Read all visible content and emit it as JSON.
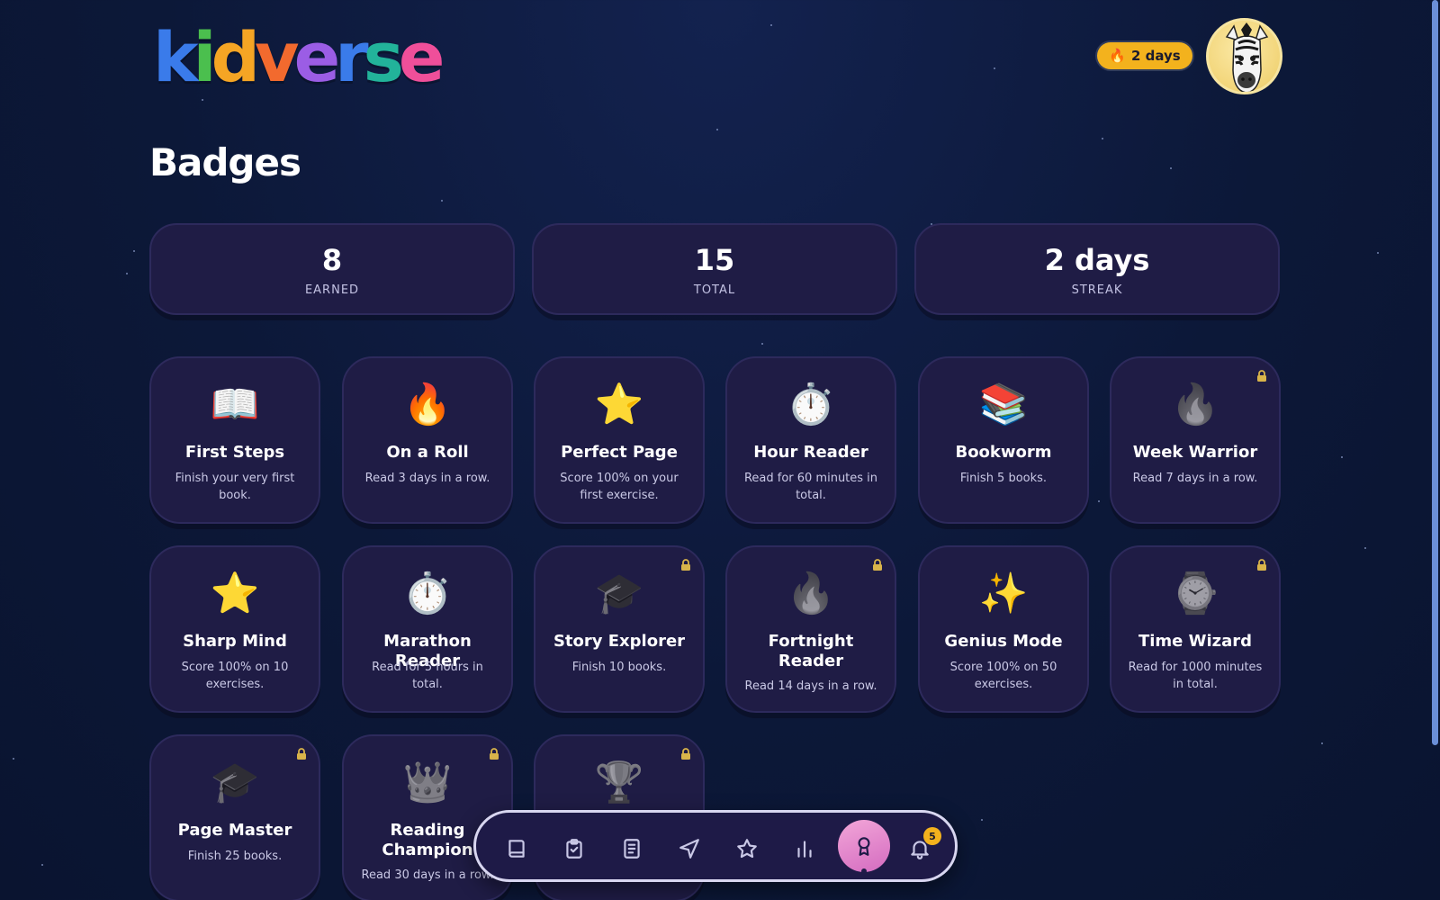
{
  "header": {
    "logo_letters": [
      {
        "char": "k",
        "color": "#3a7bea"
      },
      {
        "char": "i",
        "color": "#4bbf4e"
      },
      {
        "char": "d",
        "color": "#f5a524"
      },
      {
        "char": "v",
        "color": "#f26a2e"
      },
      {
        "char": "e",
        "color": "#9b5de5"
      },
      {
        "char": "r",
        "color": "#3a7bea"
      },
      {
        "char": "s",
        "color": "#22b39a"
      },
      {
        "char": "e",
        "color": "#ef4f9a"
      }
    ],
    "streak_label": "2 days",
    "streak_icon": "fire-icon",
    "avatar_icon": "zebra-avatar"
  },
  "page": {
    "title": "Badges"
  },
  "stats": [
    {
      "value": "8",
      "label": "EARNED"
    },
    {
      "value": "15",
      "label": "TOTAL"
    },
    {
      "value": "2 days",
      "label": "STREAK"
    }
  ],
  "badges": [
    {
      "icon": "📖",
      "icon_name": "open-book-icon",
      "name": "First Steps",
      "desc": "Finish your very first book.",
      "locked": false
    },
    {
      "icon": "🔥",
      "icon_name": "fire-icon",
      "name": "On a Roll",
      "desc": "Read 3 days in a row.",
      "locked": false
    },
    {
      "icon": "⭐",
      "icon_name": "star-icon",
      "name": "Perfect Page",
      "desc": "Score 100% on your first exercise.",
      "locked": false
    },
    {
      "icon": "⏱️",
      "icon_name": "stopwatch-icon",
      "name": "Hour Reader",
      "desc": "Read for 60 minutes in total.",
      "locked": false
    },
    {
      "icon": "📚",
      "icon_name": "books-icon",
      "name": "Bookworm",
      "desc": "Finish 5 books.",
      "locked": false
    },
    {
      "icon": "🔥",
      "icon_name": "fire-icon",
      "name": "Week Warrior",
      "desc": "Read 7 days in a row.",
      "locked": true
    },
    {
      "icon": "⭐",
      "icon_name": "star-icon",
      "name": "Sharp Mind",
      "desc": "Score 100% on 10 exercises.",
      "locked": false
    },
    {
      "icon": "⏱️",
      "icon_name": "stopwatch-icon",
      "name": "Marathon Reader",
      "desc": "Read for 5 hours in total.",
      "locked": false
    },
    {
      "icon": "🎓",
      "icon_name": "graduation-cap-icon",
      "name": "Story Explorer",
      "desc": "Finish 10 books.",
      "locked": true
    },
    {
      "icon": "🔥",
      "icon_name": "fire-icon",
      "name": "Fortnight Reader",
      "desc": "Read 14 days in a row.",
      "locked": true
    },
    {
      "icon": "✨",
      "icon_name": "sparkles-icon",
      "name": "Genius Mode",
      "desc": "Score 100% on 50 exercises.",
      "locked": false
    },
    {
      "icon": "⌚",
      "icon_name": "watch-icon",
      "name": "Time Wizard",
      "desc": "Read for 1000 minutes in total.",
      "locked": true
    },
    {
      "icon": "🎓",
      "icon_name": "graduation-cap-icon",
      "name": "Page Master",
      "desc": "Finish 25 books.",
      "locked": true
    },
    {
      "icon": "👑",
      "icon_name": "crown-icon",
      "name": "Reading Champion",
      "desc": "Read 30 days in a row.",
      "locked": true
    },
    {
      "icon": "🏆",
      "icon_name": "trophy-icon",
      "name": "",
      "desc": "",
      "locked": true
    }
  ],
  "bottom_nav": {
    "items": [
      {
        "icon": "book-icon"
      },
      {
        "icon": "clipboard-check-icon"
      },
      {
        "icon": "document-icon"
      },
      {
        "icon": "navigation-arrow-icon"
      },
      {
        "icon": "star-outline-icon"
      },
      {
        "icon": "bar-chart-icon"
      },
      {
        "icon": "award-ribbon-icon",
        "active": true
      },
      {
        "icon": "bell-icon"
      }
    ],
    "notification_count": "5"
  },
  "colors": {
    "background": "#0c1838",
    "card": "#1f1c45",
    "accent_gold": "#f3b21d",
    "active_pink": "#d46bc0"
  }
}
